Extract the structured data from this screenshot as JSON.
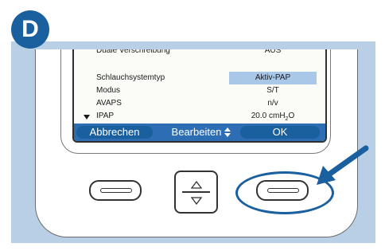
{
  "badge": "D",
  "screen": {
    "rows": [
      {
        "label": "Duale Verschreibung",
        "value": "AUS",
        "highlight": false,
        "cut": true
      },
      {
        "label": "Schlauchsystemtyp",
        "value": "Aktiv-PAP",
        "highlight": true
      },
      {
        "label": "Modus",
        "value": "S/T",
        "highlight": false
      },
      {
        "label": "AVAPS",
        "value": "n/v",
        "highlight": false
      },
      {
        "label": "IPAP",
        "value": "20.0 cmH",
        "unit_sub": "2",
        "unit_tail": "O",
        "highlight": false
      }
    ],
    "softkeys": {
      "left": "Abbrechen",
      "middle": "Bearbeiten",
      "right": "OK"
    }
  },
  "colors": {
    "accent": "#1a5f9e",
    "panel": "#b8cfe6",
    "highlight": "#a9c8e8"
  }
}
